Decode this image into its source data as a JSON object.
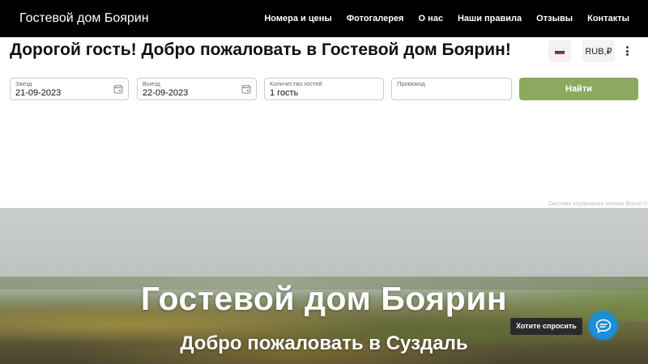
{
  "header": {
    "brand": "Гостевой дом Боярин",
    "nav": [
      "Номера и цены",
      "Фотогалерея",
      "О нас",
      "Наши правила",
      "Отзывы",
      "Контакты"
    ]
  },
  "booking": {
    "welcome": "Дорогой гость! Добро пожаловать в Гостевой дом Боярин!",
    "currency": "RUB,₽",
    "checkin": {
      "label": "Заезд",
      "value": "21-09-2023"
    },
    "checkout": {
      "label": "Выезд",
      "value": "22-09-2023"
    },
    "guests": {
      "label": "Количество гостей",
      "value": "1 гость"
    },
    "promo": {
      "label": "Промокод",
      "value": ""
    },
    "search_label": "Найти",
    "powered_by": "Система управления отелем Bnovo ©"
  },
  "hero": {
    "title": "Гостевой дом Боярин",
    "subtitle": "Добро пожаловать в Суздаль"
  },
  "chat": {
    "prompt": "Хотите спросить"
  },
  "icons": {
    "language_flag": "russia-flag-icon",
    "menu": "more-vertical-icon",
    "calendar": "calendar-icon",
    "chat": "chat-bubble-icon"
  },
  "colors": {
    "header_bg": "#000000",
    "search_button": "#8caa5f",
    "chat_button": "#1a8fd6",
    "flag_white": "#ffffff",
    "flag_blue": "#1c3fa8",
    "flag_red": "#d52b1e"
  }
}
